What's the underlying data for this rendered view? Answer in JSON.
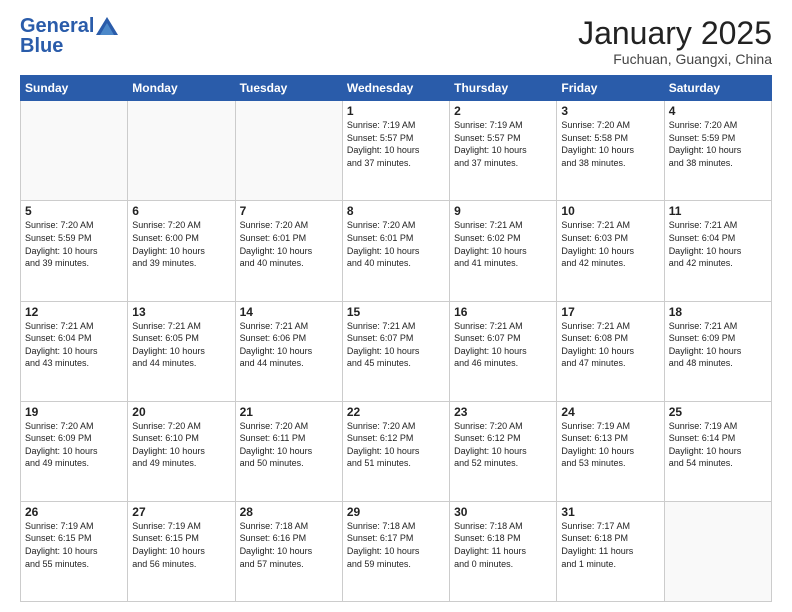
{
  "header": {
    "logo_general": "General",
    "logo_blue": "Blue",
    "month_title": "January 2025",
    "subtitle": "Fuchuan, Guangxi, China"
  },
  "days_of_week": [
    "Sunday",
    "Monday",
    "Tuesday",
    "Wednesday",
    "Thursday",
    "Friday",
    "Saturday"
  ],
  "weeks": [
    [
      {
        "day": "",
        "info": ""
      },
      {
        "day": "",
        "info": ""
      },
      {
        "day": "",
        "info": ""
      },
      {
        "day": "1",
        "info": "Sunrise: 7:19 AM\nSunset: 5:57 PM\nDaylight: 10 hours\nand 37 minutes."
      },
      {
        "day": "2",
        "info": "Sunrise: 7:19 AM\nSunset: 5:57 PM\nDaylight: 10 hours\nand 37 minutes."
      },
      {
        "day": "3",
        "info": "Sunrise: 7:20 AM\nSunset: 5:58 PM\nDaylight: 10 hours\nand 38 minutes."
      },
      {
        "day": "4",
        "info": "Sunrise: 7:20 AM\nSunset: 5:59 PM\nDaylight: 10 hours\nand 38 minutes."
      }
    ],
    [
      {
        "day": "5",
        "info": "Sunrise: 7:20 AM\nSunset: 5:59 PM\nDaylight: 10 hours\nand 39 minutes."
      },
      {
        "day": "6",
        "info": "Sunrise: 7:20 AM\nSunset: 6:00 PM\nDaylight: 10 hours\nand 39 minutes."
      },
      {
        "day": "7",
        "info": "Sunrise: 7:20 AM\nSunset: 6:01 PM\nDaylight: 10 hours\nand 40 minutes."
      },
      {
        "day": "8",
        "info": "Sunrise: 7:20 AM\nSunset: 6:01 PM\nDaylight: 10 hours\nand 40 minutes."
      },
      {
        "day": "9",
        "info": "Sunrise: 7:21 AM\nSunset: 6:02 PM\nDaylight: 10 hours\nand 41 minutes."
      },
      {
        "day": "10",
        "info": "Sunrise: 7:21 AM\nSunset: 6:03 PM\nDaylight: 10 hours\nand 42 minutes."
      },
      {
        "day": "11",
        "info": "Sunrise: 7:21 AM\nSunset: 6:04 PM\nDaylight: 10 hours\nand 42 minutes."
      }
    ],
    [
      {
        "day": "12",
        "info": "Sunrise: 7:21 AM\nSunset: 6:04 PM\nDaylight: 10 hours\nand 43 minutes."
      },
      {
        "day": "13",
        "info": "Sunrise: 7:21 AM\nSunset: 6:05 PM\nDaylight: 10 hours\nand 44 minutes."
      },
      {
        "day": "14",
        "info": "Sunrise: 7:21 AM\nSunset: 6:06 PM\nDaylight: 10 hours\nand 44 minutes."
      },
      {
        "day": "15",
        "info": "Sunrise: 7:21 AM\nSunset: 6:07 PM\nDaylight: 10 hours\nand 45 minutes."
      },
      {
        "day": "16",
        "info": "Sunrise: 7:21 AM\nSunset: 6:07 PM\nDaylight: 10 hours\nand 46 minutes."
      },
      {
        "day": "17",
        "info": "Sunrise: 7:21 AM\nSunset: 6:08 PM\nDaylight: 10 hours\nand 47 minutes."
      },
      {
        "day": "18",
        "info": "Sunrise: 7:21 AM\nSunset: 6:09 PM\nDaylight: 10 hours\nand 48 minutes."
      }
    ],
    [
      {
        "day": "19",
        "info": "Sunrise: 7:20 AM\nSunset: 6:09 PM\nDaylight: 10 hours\nand 49 minutes."
      },
      {
        "day": "20",
        "info": "Sunrise: 7:20 AM\nSunset: 6:10 PM\nDaylight: 10 hours\nand 49 minutes."
      },
      {
        "day": "21",
        "info": "Sunrise: 7:20 AM\nSunset: 6:11 PM\nDaylight: 10 hours\nand 50 minutes."
      },
      {
        "day": "22",
        "info": "Sunrise: 7:20 AM\nSunset: 6:12 PM\nDaylight: 10 hours\nand 51 minutes."
      },
      {
        "day": "23",
        "info": "Sunrise: 7:20 AM\nSunset: 6:12 PM\nDaylight: 10 hours\nand 52 minutes."
      },
      {
        "day": "24",
        "info": "Sunrise: 7:19 AM\nSunset: 6:13 PM\nDaylight: 10 hours\nand 53 minutes."
      },
      {
        "day": "25",
        "info": "Sunrise: 7:19 AM\nSunset: 6:14 PM\nDaylight: 10 hours\nand 54 minutes."
      }
    ],
    [
      {
        "day": "26",
        "info": "Sunrise: 7:19 AM\nSunset: 6:15 PM\nDaylight: 10 hours\nand 55 minutes."
      },
      {
        "day": "27",
        "info": "Sunrise: 7:19 AM\nSunset: 6:15 PM\nDaylight: 10 hours\nand 56 minutes."
      },
      {
        "day": "28",
        "info": "Sunrise: 7:18 AM\nSunset: 6:16 PM\nDaylight: 10 hours\nand 57 minutes."
      },
      {
        "day": "29",
        "info": "Sunrise: 7:18 AM\nSunset: 6:17 PM\nDaylight: 10 hours\nand 59 minutes."
      },
      {
        "day": "30",
        "info": "Sunrise: 7:18 AM\nSunset: 6:18 PM\nDaylight: 11 hours\nand 0 minutes."
      },
      {
        "day": "31",
        "info": "Sunrise: 7:17 AM\nSunset: 6:18 PM\nDaylight: 11 hours\nand 1 minute."
      },
      {
        "day": "",
        "info": ""
      }
    ]
  ]
}
